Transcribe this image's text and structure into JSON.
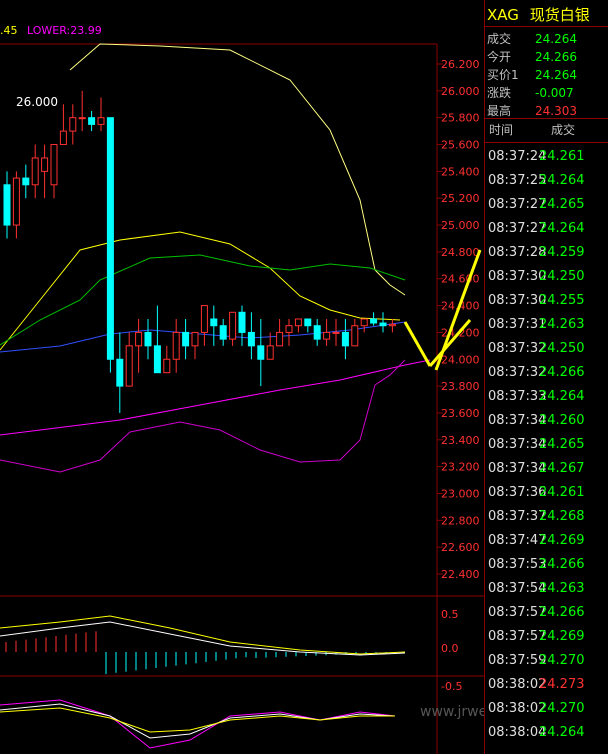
{
  "legend": {
    "mid_fragment": ".45",
    "lower_label": "LOWER:23.99"
  },
  "main_annotation": "26.000",
  "y_axis_labels": [
    "26.200",
    "26.000",
    "25.800",
    "25.600",
    "25.400",
    "25.200",
    "25.000",
    "24.800",
    "24.600",
    "24.400",
    "24.200",
    "24.000",
    "23.800",
    "23.600",
    "23.400",
    "23.200",
    "23.000",
    "22.800",
    "22.600",
    "22.400"
  ],
  "macd_axis_labels": [
    "0.5",
    "0.0",
    "-0.5"
  ],
  "panel": {
    "code": "XAG",
    "name": "现货白银",
    "quote": [
      {
        "label": "成交",
        "value": "24.264",
        "color": "#00ff00"
      },
      {
        "label": "今开",
        "value": "24.266",
        "color": "#00ff00"
      },
      {
        "label": "买价1",
        "value": "24.264",
        "color": "#00ff00"
      },
      {
        "label": "涨跌",
        "value": "-0.007",
        "color": "#00ff00"
      },
      {
        "label": "最高",
        "value": "24.303",
        "color": "#ff3030"
      }
    ],
    "tick_header": {
      "time": "时间",
      "price": "成交"
    },
    "ticks": [
      {
        "time": "08:37:24",
        "price": "24.261",
        "dir": "g"
      },
      {
        "time": "08:37:25",
        "price": "24.264",
        "dir": "g"
      },
      {
        "time": "08:37:27",
        "price": "24.265",
        "dir": "g"
      },
      {
        "time": "08:37:27",
        "price": "24.264",
        "dir": "g"
      },
      {
        "time": "08:37:28",
        "price": "24.259",
        "dir": "g"
      },
      {
        "time": "08:37:30",
        "price": "24.250",
        "dir": "g"
      },
      {
        "time": "08:37:30",
        "price": "24.255",
        "dir": "g"
      },
      {
        "time": "08:37:31",
        "price": "24.263",
        "dir": "g"
      },
      {
        "time": "08:37:32",
        "price": "24.250",
        "dir": "g"
      },
      {
        "time": "08:37:32",
        "price": "24.266",
        "dir": "g"
      },
      {
        "time": "08:37:33",
        "price": "24.264",
        "dir": "g"
      },
      {
        "time": "08:37:34",
        "price": "24.260",
        "dir": "g"
      },
      {
        "time": "08:37:34",
        "price": "24.265",
        "dir": "g"
      },
      {
        "time": "08:37:34",
        "price": "24.267",
        "dir": "g"
      },
      {
        "time": "08:37:36",
        "price": "24.261",
        "dir": "g"
      },
      {
        "time": "08:37:37",
        "price": "24.268",
        "dir": "g"
      },
      {
        "time": "08:37:47",
        "price": "24.269",
        "dir": "g"
      },
      {
        "time": "08:37:53",
        "price": "24.266",
        "dir": "g"
      },
      {
        "time": "08:37:54",
        "price": "24.263",
        "dir": "g"
      },
      {
        "time": "08:37:57",
        "price": "24.266",
        "dir": "g"
      },
      {
        "time": "08:37:57",
        "price": "24.269",
        "dir": "g"
      },
      {
        "time": "08:37:59",
        "price": "24.270",
        "dir": "g"
      },
      {
        "time": "08:38:02",
        "price": "24.273",
        "dir": "r"
      },
      {
        "time": "08:38:02",
        "price": "24.270",
        "dir": "g"
      },
      {
        "time": "08:38:04",
        "price": "24.264",
        "dir": "g"
      }
    ]
  },
  "watermark": "www.jrwei.com",
  "colors": {
    "up": "#ff3030",
    "down": "#00ffff",
    "accent": "#ffff00",
    "grid": "#8b0000"
  },
  "chart_data": {
    "type": "candlestick",
    "ylim": [
      22.3,
      26.3
    ],
    "candles": [
      [
        25.3,
        25.4,
        24.9,
        25.0
      ],
      [
        25.0,
        25.4,
        24.9,
        25.35
      ],
      [
        25.35,
        25.45,
        25.2,
        25.3
      ],
      [
        25.3,
        25.6,
        25.2,
        25.5
      ],
      [
        25.4,
        25.6,
        25.2,
        25.5
      ],
      [
        25.3,
        25.6,
        25.2,
        25.6
      ],
      [
        25.6,
        25.9,
        25.6,
        25.7
      ],
      [
        25.7,
        25.9,
        25.6,
        25.8
      ],
      [
        25.8,
        26.0,
        25.7,
        25.8
      ],
      [
        25.8,
        25.85,
        25.7,
        25.75
      ],
      [
        25.75,
        25.95,
        25.7,
        25.8
      ],
      [
        25.8,
        25.8,
        23.9,
        24.0
      ],
      [
        24.0,
        24.2,
        23.6,
        23.8
      ],
      [
        23.8,
        24.2,
        23.8,
        24.1
      ],
      [
        24.1,
        24.3,
        23.9,
        24.2
      ],
      [
        24.2,
        24.3,
        24.0,
        24.1
      ],
      [
        24.1,
        24.4,
        23.9,
        23.9
      ],
      [
        23.9,
        24.1,
        23.9,
        24.0
      ],
      [
        24.0,
        24.3,
        23.9,
        24.2
      ],
      [
        24.2,
        24.3,
        24.0,
        24.1
      ],
      [
        24.1,
        24.2,
        24.0,
        24.2
      ],
      [
        24.2,
        24.4,
        24.1,
        24.4
      ],
      [
        24.3,
        24.4,
        24.1,
        24.25
      ],
      [
        24.25,
        24.3,
        24.1,
        24.15
      ],
      [
        24.15,
        24.35,
        24.1,
        24.35
      ],
      [
        24.35,
        24.4,
        24.1,
        24.2
      ],
      [
        24.2,
        24.35,
        24.0,
        24.1
      ],
      [
        24.1,
        24.3,
        23.8,
        24.0
      ],
      [
        24.0,
        24.2,
        24.0,
        24.1
      ],
      [
        24.1,
        24.3,
        24.1,
        24.2
      ],
      [
        24.2,
        24.3,
        24.1,
        24.25
      ],
      [
        24.25,
        24.3,
        24.2,
        24.3
      ],
      [
        24.3,
        24.3,
        24.2,
        24.25
      ],
      [
        24.25,
        24.3,
        24.1,
        24.15
      ],
      [
        24.15,
        24.3,
        24.1,
        24.2
      ],
      [
        24.2,
        24.3,
        24.1,
        24.2
      ],
      [
        24.2,
        24.3,
        24.0,
        24.1
      ],
      [
        24.1,
        24.3,
        24.1,
        24.25
      ],
      [
        24.25,
        24.3,
        24.2,
        24.3
      ],
      [
        24.3,
        24.35,
        24.25,
        24.27
      ],
      [
        24.27,
        24.35,
        24.2,
        24.25
      ],
      [
        24.25,
        24.3,
        24.2,
        24.26
      ]
    ]
  }
}
